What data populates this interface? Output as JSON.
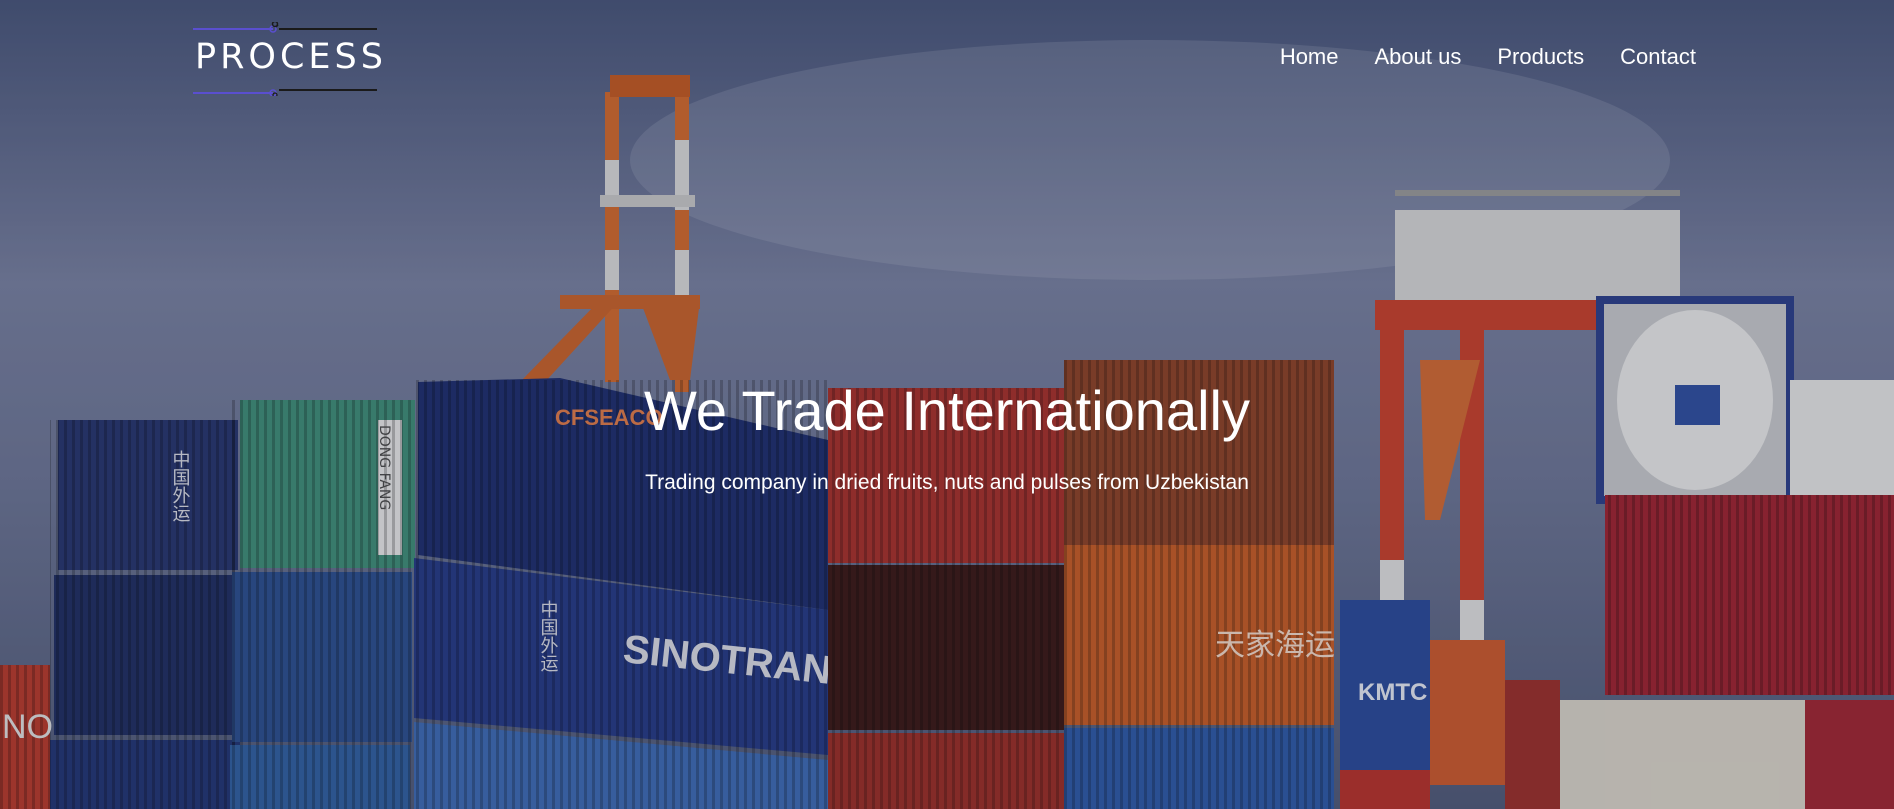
{
  "brand": {
    "logo_text": "PROCESS",
    "accent_color": "#5a4fcf",
    "line_color": "#1a1a1a"
  },
  "nav": {
    "items": [
      {
        "label": "Home"
      },
      {
        "label": "About us"
      },
      {
        "label": "Products"
      },
      {
        "label": "Contact"
      }
    ]
  },
  "hero": {
    "title": "We Trade Internationally",
    "subtitle": "Trading company in dried fruits, nuts and pulses from Uzbekistan"
  },
  "background_scene": {
    "container_labels": [
      "SINOTRANS",
      "CFSEACO",
      "DONG FANG",
      "KMTC",
      "中国外运",
      "天家海运"
    ]
  }
}
